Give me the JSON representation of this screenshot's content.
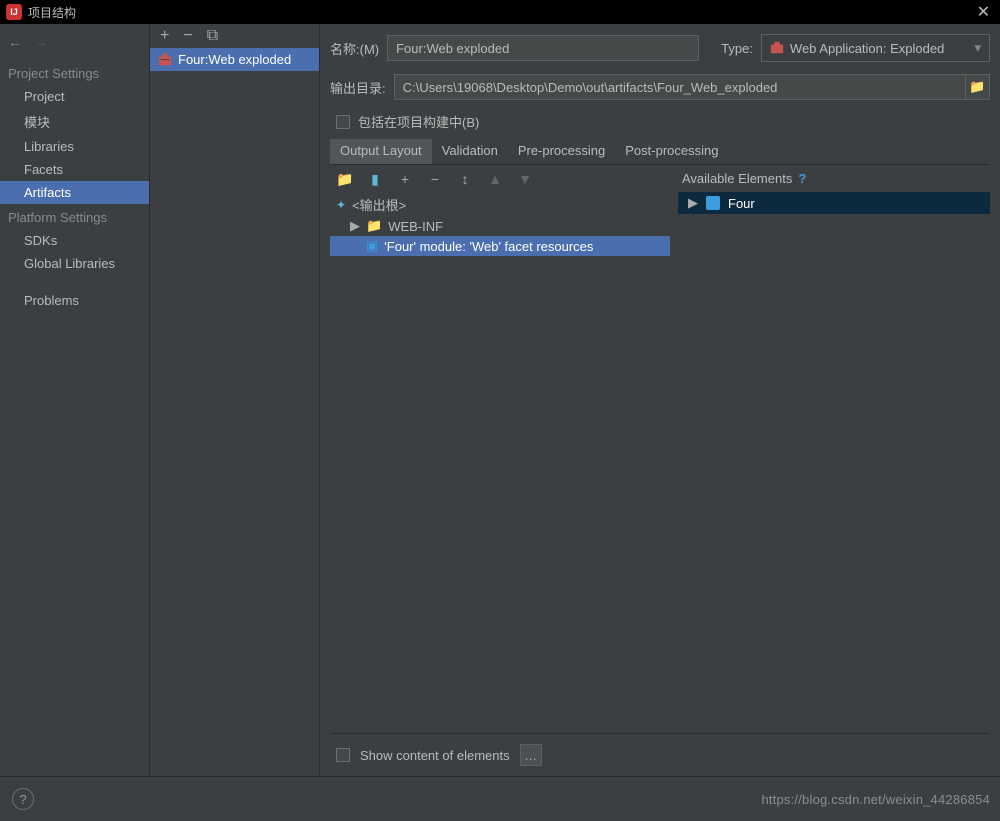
{
  "window": {
    "title": "项目结构"
  },
  "sidebar": {
    "section1": "Project Settings",
    "items1": [
      "Project",
      "模块",
      "Libraries",
      "Facets",
      "Artifacts"
    ],
    "section2": "Platform Settings",
    "items2": [
      "SDKs",
      "Global Libraries"
    ],
    "problems": "Problems"
  },
  "artifactsList": {
    "item": "Four:Web exploded"
  },
  "detail": {
    "nameLabel": "名称:(M)",
    "nameValue": "Four:Web exploded",
    "typeLabel": "Type:",
    "typeValue": "Web Application: Exploded",
    "outputLabel": "输出目录:",
    "outputValue": "C:\\Users\\19068\\Desktop\\Demo\\out\\artifacts\\Four_Web_exploded",
    "includeLabel": "包括在项目构建中(B)"
  },
  "tabs": [
    "Output Layout",
    "Validation",
    "Pre-processing",
    "Post-processing"
  ],
  "tree": {
    "root": "<输出根>",
    "webinf": "WEB-INF",
    "facet": "'Four' module: 'Web' facet resources"
  },
  "available": {
    "header": "Available Elements",
    "item": "Four"
  },
  "showContent": "Show content of elements",
  "watermark": "https://blog.csdn.net/weixin_44286854"
}
